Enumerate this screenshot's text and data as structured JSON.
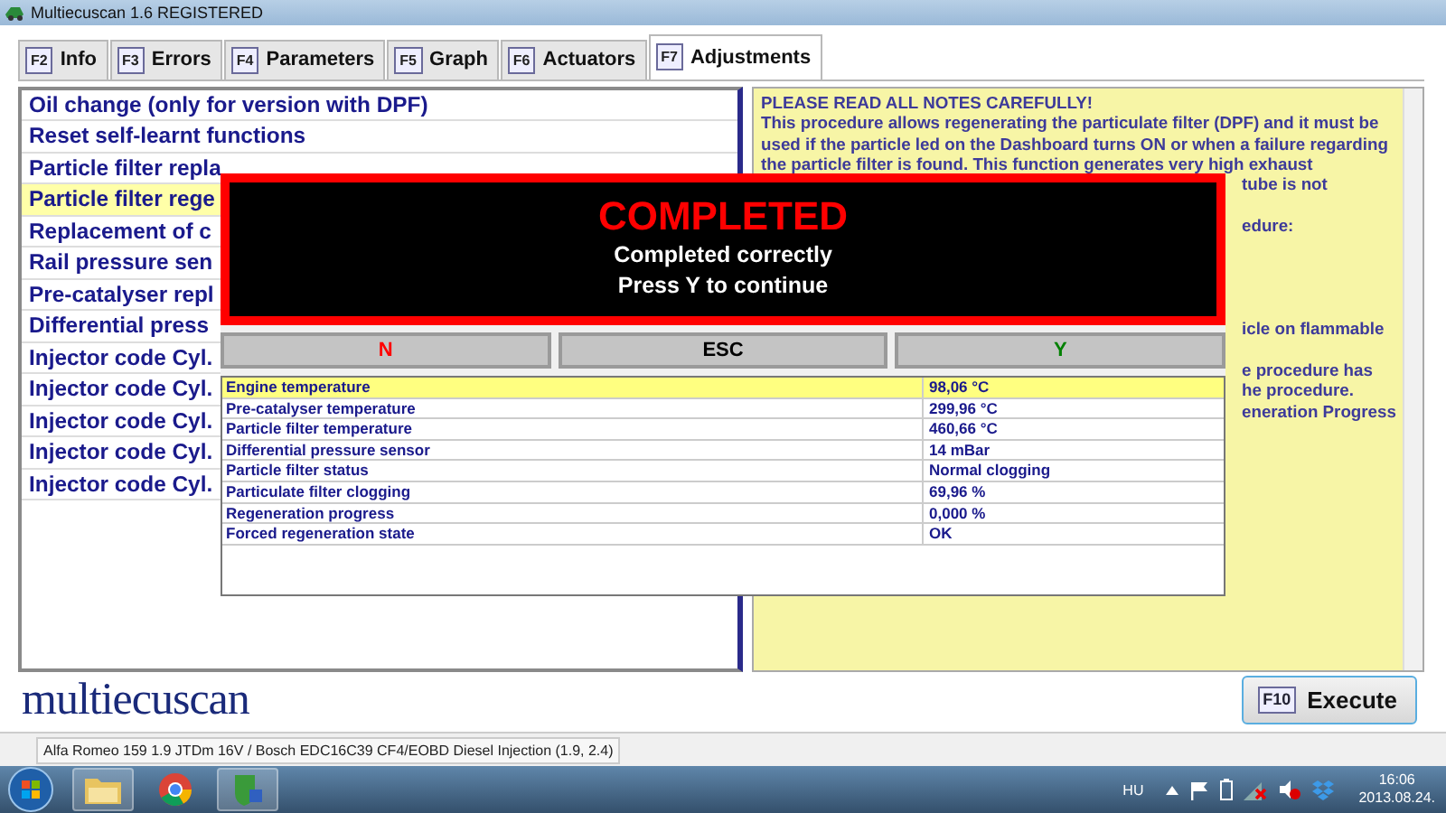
{
  "window": {
    "title": "Multiecuscan 1.6 REGISTERED"
  },
  "tabs": [
    {
      "key": "F2",
      "label": "Info",
      "selected": false
    },
    {
      "key": "F3",
      "label": "Errors",
      "selected": false
    },
    {
      "key": "F4",
      "label": "Parameters",
      "selected": false
    },
    {
      "key": "F5",
      "label": "Graph",
      "selected": false
    },
    {
      "key": "F6",
      "label": "Actuators",
      "selected": false
    },
    {
      "key": "F7",
      "label": "Adjustments",
      "selected": true
    }
  ],
  "functions": [
    {
      "label": "Oil change (only for version with DPF)",
      "selected": false
    },
    {
      "label": "Reset self-learnt functions",
      "selected": false
    },
    {
      "label": "Particle filter repla",
      "selected": false
    },
    {
      "label": "Particle filter rege",
      "selected": true
    },
    {
      "label": "Replacement of c",
      "selected": false
    },
    {
      "label": "Rail pressure sen",
      "selected": false
    },
    {
      "label": "Pre-catalyser repl",
      "selected": false
    },
    {
      "label": "Differential press",
      "selected": false
    },
    {
      "label": "Injector code Cyl.",
      "selected": false
    },
    {
      "label": "Injector code Cyl.",
      "selected": false
    },
    {
      "label": "Injector code Cyl.",
      "selected": false
    },
    {
      "label": "Injector code Cyl.",
      "selected": false
    },
    {
      "label": "Injector code Cyl.",
      "selected": false
    }
  ],
  "notes": {
    "heading": "PLEASE READ ALL NOTES CAREFULLY!",
    "lines": [
      {
        "kind": "full",
        "text": "This procedure allows regenerating the particulate filter (DPF) and it must be"
      },
      {
        "kind": "full",
        "text": "used if the particle led on the Dashboard turns ON or when a failure regarding"
      },
      {
        "kind": "full",
        "text": "the particle filter is found. This function generates very high exhaust"
      },
      {
        "kind": "tail",
        "text": "tube is not"
      },
      {
        "kind": "blank"
      },
      {
        "kind": "tail",
        "text": "edure:"
      },
      {
        "kind": "blank"
      },
      {
        "kind": "blank"
      },
      {
        "kind": "blank"
      },
      {
        "kind": "blank"
      },
      {
        "kind": "tail",
        "text": "icle on flammable"
      },
      {
        "kind": "blank"
      },
      {
        "kind": "tail",
        "text": "e procedure has"
      },
      {
        "kind": "tail",
        "text": "he procedure."
      },
      {
        "kind": "tail",
        "text": "eneration Progress"
      }
    ]
  },
  "dialog": {
    "title": "COMPLETED",
    "message_lines": [
      "Completed correctly",
      "Press Y to continue"
    ],
    "buttons": [
      {
        "label": "N",
        "color": "#ff0000"
      },
      {
        "label": "ESC",
        "color": "#000000"
      },
      {
        "label": "Y",
        "color": "#008000"
      }
    ]
  },
  "readings": [
    {
      "name": "Engine temperature",
      "value": "98,06 °C",
      "selected": true
    },
    {
      "name": "Pre-catalyser temperature",
      "value": "299,96 °C",
      "selected": false
    },
    {
      "name": "Particle filter temperature",
      "value": "460,66 °C",
      "selected": false
    },
    {
      "name": "Differential pressure sensor",
      "value": "14 mBar",
      "selected": false
    },
    {
      "name": "Particle filter status",
      "value": "Normal clogging",
      "selected": false
    },
    {
      "name": "Particulate filter clogging",
      "value": "69,96 %",
      "selected": false
    },
    {
      "name": "Regeneration progress",
      "value": "0,000 %",
      "selected": false
    },
    {
      "name": "Forced regeneration state",
      "value": "OK",
      "selected": false
    }
  ],
  "logo": "multiecuscan",
  "execute": {
    "key": "F10",
    "label": "Execute"
  },
  "status_bar": "Alfa Romeo 159 1.9 JTDm 16V / Bosch EDC16C39 CF4/EOBD Diesel Injection (1.9, 2.4)",
  "taskbar": {
    "language": "HU",
    "time": "16:06",
    "date": "2013.08.24."
  }
}
